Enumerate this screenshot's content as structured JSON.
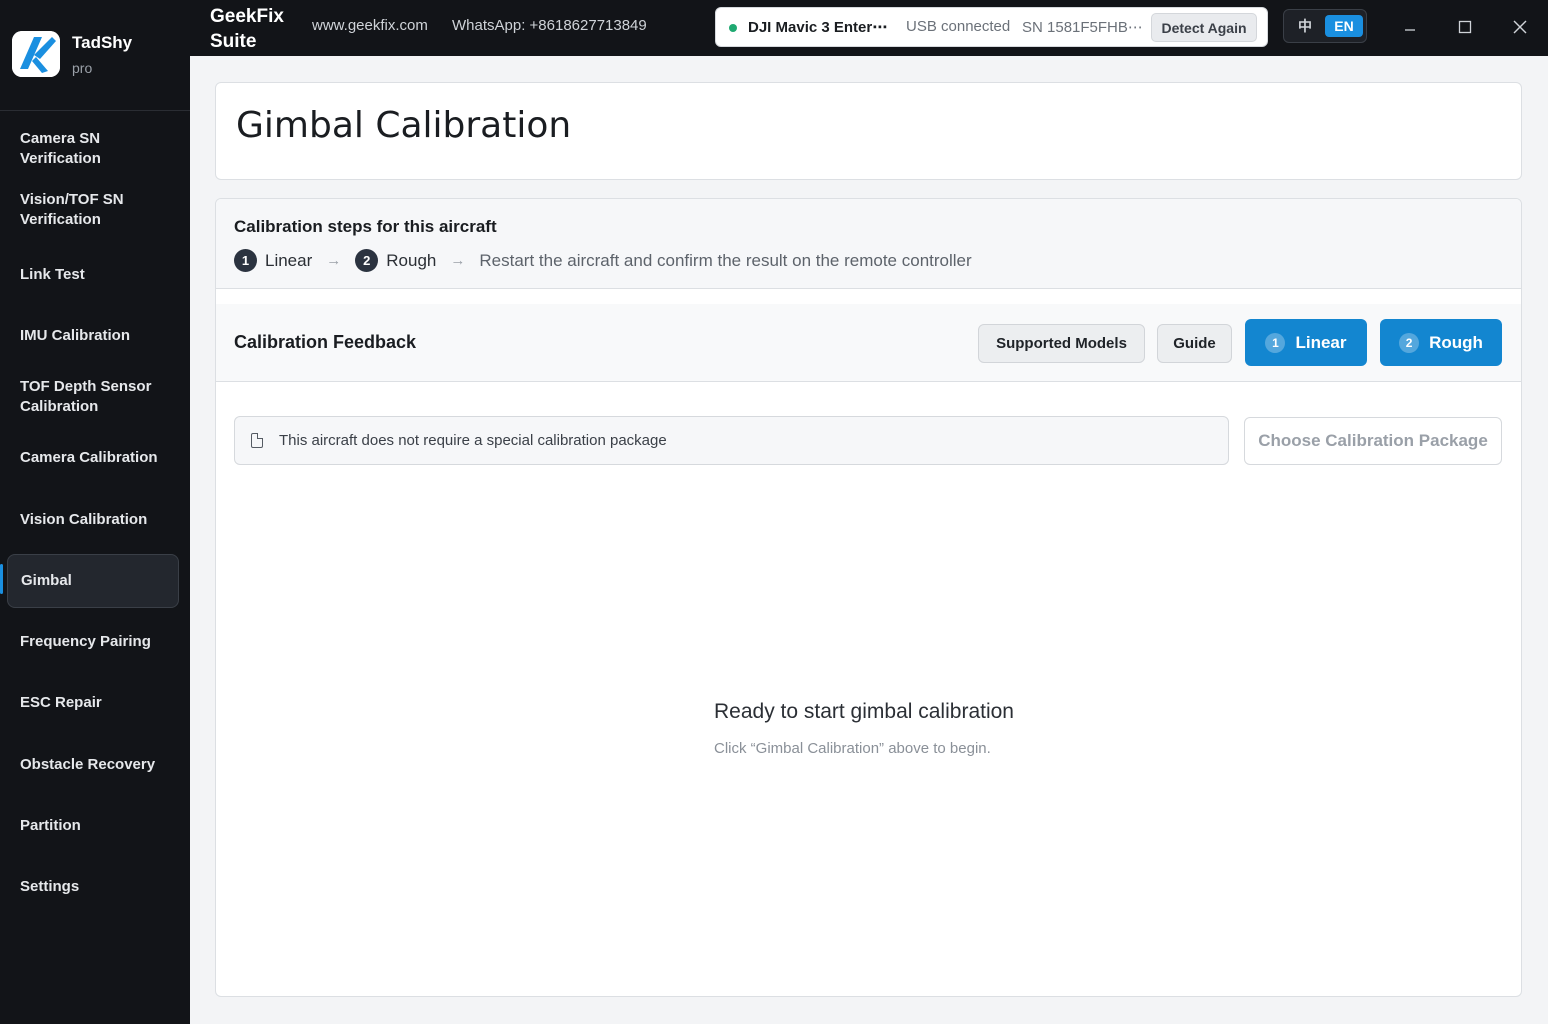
{
  "brand": {
    "name": "TadShy",
    "tier": "pro"
  },
  "app": {
    "suite": "GeekFix Suite",
    "site": "www.geekfix.com",
    "whatsapp": "WhatsApp: +8618627713849"
  },
  "device": {
    "name": "DJI Mavic 3 Enter⋯",
    "usb": "USB connected",
    "sn": "SN 1581F5FHB⋯",
    "detect_label": "Detect Again",
    "status_color": "#1fa971"
  },
  "language": {
    "zh": "中",
    "en": "EN",
    "selected": "EN"
  },
  "window_controls": [
    "minimize-icon",
    "maximize-icon",
    "close-icon"
  ],
  "sidebar": {
    "items": [
      {
        "label": "Camera SN Verification",
        "active": false
      },
      {
        "label": "Vision/TOF SN Verification",
        "active": false
      },
      {
        "label": "Link Test",
        "active": false
      },
      {
        "label": "IMU Calibration",
        "active": false
      },
      {
        "label": "TOF Depth Sensor Calibration",
        "active": false
      },
      {
        "label": "Camera Calibration",
        "active": false
      },
      {
        "label": "Vision Calibration",
        "active": false
      },
      {
        "label": "Gimbal",
        "active": true
      },
      {
        "label": "Frequency Pairing",
        "active": false
      },
      {
        "label": "ESC Repair",
        "active": false
      },
      {
        "label": "Obstacle Recovery",
        "active": false
      },
      {
        "label": "Partition",
        "active": false
      },
      {
        "label": "Settings",
        "active": false
      }
    ]
  },
  "page": {
    "title": "Gimbal Calibration"
  },
  "steps": {
    "title": "Calibration steps for this aircraft",
    "items": [
      {
        "num": "1",
        "label": "Linear"
      },
      {
        "num": "2",
        "label": "Rough"
      }
    ],
    "final": "Restart the aircraft and confirm the result on the remote controller"
  },
  "feedback": {
    "title": "Calibration Feedback",
    "supported_label": "Supported Models",
    "guide_label": "Guide",
    "linear": {
      "num": "1",
      "label": "Linear"
    },
    "rough": {
      "num": "2",
      "label": "Rough"
    }
  },
  "package": {
    "info": "This aircraft does not require a special calibration package",
    "choose_label": "Choose Calibration Package"
  },
  "empty_state": {
    "title": "Ready to start gimbal calibration",
    "subtitle": "Click “Gimbal Calibration” above to begin."
  },
  "colors": {
    "accent": "#1386d0",
    "sidebar_bg": "#121418",
    "active_marker": "#1a8fe0"
  }
}
